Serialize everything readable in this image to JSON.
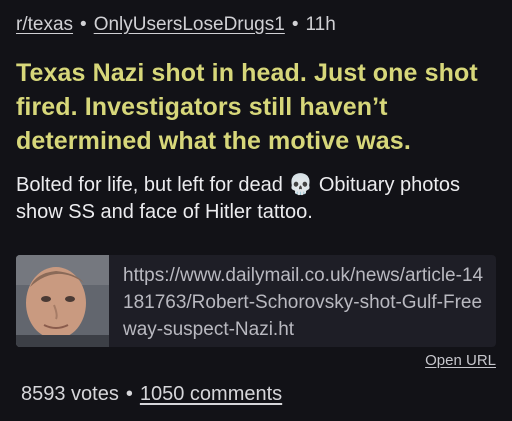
{
  "post": {
    "subreddit": "r/texas",
    "author": "OnlyUsersLoseDrugs1",
    "age": "11h",
    "separator": "•",
    "title": "Texas Nazi shot in head. Just one shot fired. Investigators still haven’t determined what the motive was.",
    "body_before_emoji": "Bolted for life, but left for dead ",
    "emoji": "💀",
    "body_after_emoji": " Obituary photos show SS and face of Hitler tattoo.",
    "link": {
      "url": "https://www.dailymail.co.uk/news/article-14181763/Robert-Schorovsky-shot-Gulf-Freeway-suspect-Nazi.ht",
      "open_label": "Open URL",
      "thumbnail": "man-portrait-photo"
    },
    "votes": "8593 votes",
    "comments": "1050 comments"
  },
  "colors": {
    "background": "#121217",
    "title": "#d7d77a",
    "card": "#1e1e26",
    "text": "#e8e8ea"
  }
}
